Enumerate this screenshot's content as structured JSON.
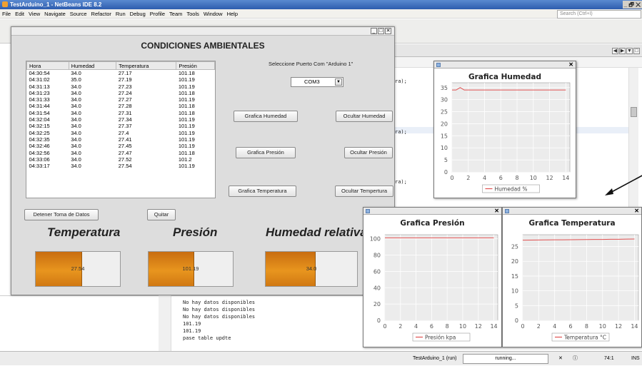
{
  "ide": {
    "title": "TestArduino_1 - NetBeans IDE 8.2",
    "window_controls": "_ 🗗 ✕",
    "menu": [
      "File",
      "Edit",
      "View",
      "Navigate",
      "Source",
      "Refactor",
      "Run",
      "Debug",
      "Profile",
      "Team",
      "Tools",
      "Window",
      "Help"
    ],
    "search_placeholder": "Search (Ctrl+I)",
    "code_lines": [
      "ra);",
      "ra);",
      "ra);"
    ],
    "output_lines": [
      "No hay datos disponibles",
      "No hay datos disponibles",
      "No hay datos disponibles",
      "101.19",
      "101.19",
      "pase table updte"
    ],
    "status": {
      "project": "TestArduino_1 (run)",
      "progress": "running...",
      "position": "74:1",
      "mode": "INS"
    }
  },
  "app": {
    "title": "CONDICIONES AMBIENTALES",
    "table": {
      "headers": [
        "Hora",
        "Humedad",
        "Temperatura",
        "Presión"
      ],
      "rows": [
        [
          "04:30:54",
          "34.0",
          "27.17",
          "101.18"
        ],
        [
          "04:31:02",
          "35.0",
          "27.19",
          "101.19"
        ],
        [
          "04:31:13",
          "34.0",
          "27.23",
          "101.19"
        ],
        [
          "04:31:23",
          "34.0",
          "27.24",
          "101.18"
        ],
        [
          "04:31:33",
          "34.0",
          "27.27",
          "101.19"
        ],
        [
          "04:31:44",
          "34.0",
          "27.28",
          "101.18"
        ],
        [
          "04:31:54",
          "34.0",
          "27.31",
          "101.18"
        ],
        [
          "04:32:04",
          "34.0",
          "27.34",
          "101.19"
        ],
        [
          "04:32:15",
          "34.0",
          "27.37",
          "101.19"
        ],
        [
          "04:32:25",
          "34.0",
          "27.4",
          "101.19"
        ],
        [
          "04:32:35",
          "34.0",
          "27.41",
          "101.19"
        ],
        [
          "04:32:46",
          "34.0",
          "27.45",
          "101.19"
        ],
        [
          "04:32:56",
          "34.0",
          "27.47",
          "101.18"
        ],
        [
          "04:33:06",
          "34.0",
          "27.52",
          "101.2"
        ],
        [
          "04:33:17",
          "34.0",
          "27.54",
          "101.19"
        ]
      ]
    },
    "port_label": "Seleccione Puerto Com \"Arduino 1\"",
    "port_value": "COM3",
    "buttons": {
      "graf_hum": "Grafica Humedad",
      "ocul_hum": "Ocultar Humedad",
      "graf_pres": "Grafica Presión",
      "ocul_pres": "Ocultar Presión",
      "graf_temp": "Grafica Temperatura",
      "ocul_temp": "Ocultar Tempertura",
      "detener": "Detener Toma de Datos",
      "quitar": "Quitar"
    },
    "labels": {
      "temp": "Temperatura",
      "pres": "Presión",
      "hum": "Humedad relativa"
    },
    "bars": {
      "temp": {
        "text": "27.54",
        "fill": 0.55
      },
      "pres": {
        "text": "101.19",
        "fill": 0.54
      },
      "hum": {
        "text": "34.0",
        "fill": 0.55
      }
    },
    "accent": "#e08a1a"
  },
  "chart_data": [
    {
      "type": "line",
      "title": "Grafica Humedad",
      "x": [
        0,
        0.5,
        1,
        1.5,
        2,
        3,
        4,
        5,
        6,
        7,
        8,
        9,
        10,
        11,
        12,
        13,
        14
      ],
      "series": [
        {
          "name": "Humedad %",
          "values": [
            34,
            34,
            35,
            34,
            34,
            34,
            34,
            34,
            34,
            34,
            34,
            34,
            34,
            34,
            34,
            34,
            34
          ],
          "color": "#e05050"
        }
      ],
      "xticks": [
        0,
        2,
        4,
        6,
        8,
        10,
        12,
        14
      ],
      "yticks": [
        0,
        5,
        10,
        15,
        20,
        25,
        30,
        35
      ],
      "xlim": [
        0,
        14.5
      ],
      "ylim": [
        0,
        37
      ],
      "grid": true,
      "legend": "bottom"
    },
    {
      "type": "line",
      "title": "Grafica Presión",
      "x": [
        0,
        1,
        2,
        3,
        4,
        5,
        6,
        7,
        8,
        9,
        10,
        11,
        12,
        13,
        14
      ],
      "series": [
        {
          "name": "Presión kpa",
          "values": [
            101.18,
            101.19,
            101.19,
            101.18,
            101.19,
            101.18,
            101.18,
            101.19,
            101.19,
            101.19,
            101.19,
            101.19,
            101.18,
            101.2,
            101.19
          ],
          "color": "#e05050"
        }
      ],
      "xticks": [
        0,
        2,
        4,
        6,
        8,
        10,
        12,
        14
      ],
      "yticks": [
        0,
        20,
        40,
        60,
        80,
        100
      ],
      "xlim": [
        0,
        14.5
      ],
      "ylim": [
        0,
        105
      ],
      "grid": true,
      "legend": "bottom"
    },
    {
      "type": "line",
      "title": "Grafica Temperatura",
      "x": [
        0,
        1,
        2,
        3,
        4,
        5,
        6,
        7,
        8,
        9,
        10,
        11,
        12,
        13,
        14
      ],
      "series": [
        {
          "name": "Temperatura °C",
          "values": [
            27.17,
            27.19,
            27.23,
            27.24,
            27.27,
            27.28,
            27.31,
            27.34,
            27.37,
            27.4,
            27.41,
            27.45,
            27.47,
            27.52,
            27.54
          ],
          "color": "#e05050"
        }
      ],
      "xticks": [
        0,
        2,
        4,
        6,
        8,
        10,
        12,
        14
      ],
      "yticks": [
        0,
        5,
        10,
        15,
        20,
        25
      ],
      "xlim": [
        0,
        14.5
      ],
      "ylim": [
        0,
        29
      ],
      "grid": true,
      "legend": "bottom"
    }
  ]
}
